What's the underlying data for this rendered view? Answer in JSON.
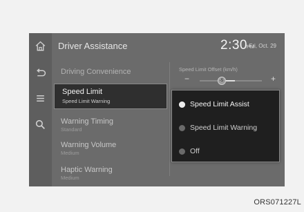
{
  "header": {
    "title": "Driver Assistance",
    "time": "2:30",
    "ampm": "PM",
    "date": "Fri, Oct. 29"
  },
  "rail": {
    "icons": [
      "home-icon",
      "back-icon",
      "menu-icon",
      "search-icon"
    ]
  },
  "menu": {
    "items": [
      {
        "label": "Driving Convenience",
        "sublabel": ""
      },
      {
        "label": "Speed Limit",
        "sublabel": "Speed Limit Warning"
      },
      {
        "label": "Warning Timing",
        "sublabel": "Standard"
      },
      {
        "label": "Warning Volume",
        "sublabel": "Medium"
      },
      {
        "label": "Haptic Warning",
        "sublabel": "Medium"
      }
    ]
  },
  "offset": {
    "label": "Speed Limit Offset (km/h)",
    "minus": "−",
    "plus": "+",
    "value": "-5",
    "position": 0.35
  },
  "popup": {
    "options": [
      {
        "label": "Speed Limit Assist",
        "selected": true
      },
      {
        "label": "Speed Limit Warning",
        "selected": false
      },
      {
        "label": "Off",
        "selected": false
      }
    ]
  },
  "watermark": "ORS071227L",
  "colors": {
    "screen_bg": "#6b6b6b",
    "popup_bg": "#1f1f1f",
    "selected_bg": "#2f2f2f"
  }
}
